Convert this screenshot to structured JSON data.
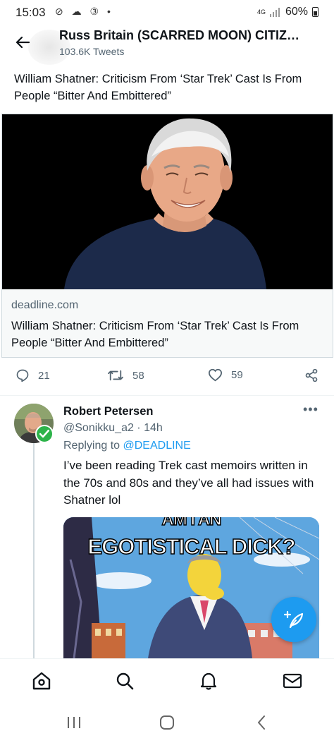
{
  "status_bar": {
    "time": "15:03",
    "left_icons": "⊘ ☁ ③ •",
    "network": "4G",
    "battery": "60%"
  },
  "header": {
    "title": "Russ Britain (SCARRED MOON) CITIZ…",
    "subtitle": "103.6K Tweets"
  },
  "tweet": {
    "text": "William Shatner: Criticism From ‘Star Trek’ Cast Is From People “Bitter And Embittered”",
    "card": {
      "domain": "deadline.com",
      "title": "William Shatner: Criticism From ‘Star Trek’ Cast Is From People “Bitter And Embittered”"
    },
    "actions": {
      "replies": "21",
      "retweets": "58",
      "likes": "59"
    }
  },
  "reply": {
    "name": "Robert Petersen",
    "handle": "@Sonikku_a2 · 14h",
    "replying_prefix": "Replying to",
    "replying_to": "@DEADLINE",
    "text": "I’ve been reading Trek cast memoirs  written in the 70s and 80s and they’ve all had issues with Shatner lol",
    "meme_line1": "AM I AN",
    "meme_line2": "EGOTISTICAL DICK?",
    "more": "•••"
  },
  "colors": {
    "accent": "#1d9bf0",
    "secondary_text": "#536471",
    "verified": "#2db34a"
  },
  "icons": {
    "back": "arrow-left-icon",
    "reply": "reply-bubble-icon",
    "retweet": "retweet-icon",
    "like": "heart-icon",
    "share": "share-icon",
    "compose": "compose-feather-icon",
    "home": "home-icon",
    "search": "search-icon",
    "notifications": "bell-icon",
    "messages": "mail-icon"
  }
}
